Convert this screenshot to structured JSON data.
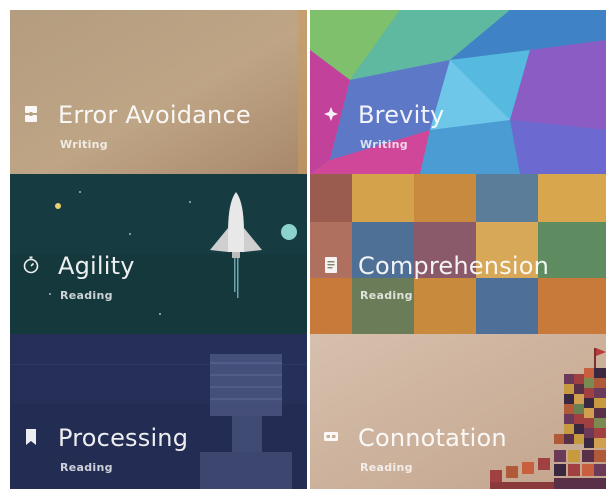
{
  "tiles": [
    {
      "title": "Error Avoidance",
      "subtitle": "Writing",
      "icon": "puzzle-icon",
      "theme": "sand",
      "color": "#b89e7e"
    },
    {
      "title": "Brevity",
      "subtitle": "Writing",
      "icon": "compass-arrows-icon",
      "theme": "polygon",
      "color": "#4aa3c9"
    },
    {
      "title": "Agility",
      "subtitle": "Reading",
      "icon": "stopwatch-icon",
      "theme": "space",
      "color": "#133e42"
    },
    {
      "title": "Comprehension",
      "subtitle": "Reading",
      "icon": "document-icon",
      "theme": "squares",
      "color": "#7d8a6a"
    },
    {
      "title": "Processing",
      "subtitle": "Reading",
      "icon": "bookmark-icon",
      "theme": "navy",
      "color": "#24315a"
    },
    {
      "title": "Connotation",
      "subtitle": "Reading",
      "icon": "speech-bubble-icon",
      "theme": "castle",
      "color": "#c9b09a"
    }
  ]
}
